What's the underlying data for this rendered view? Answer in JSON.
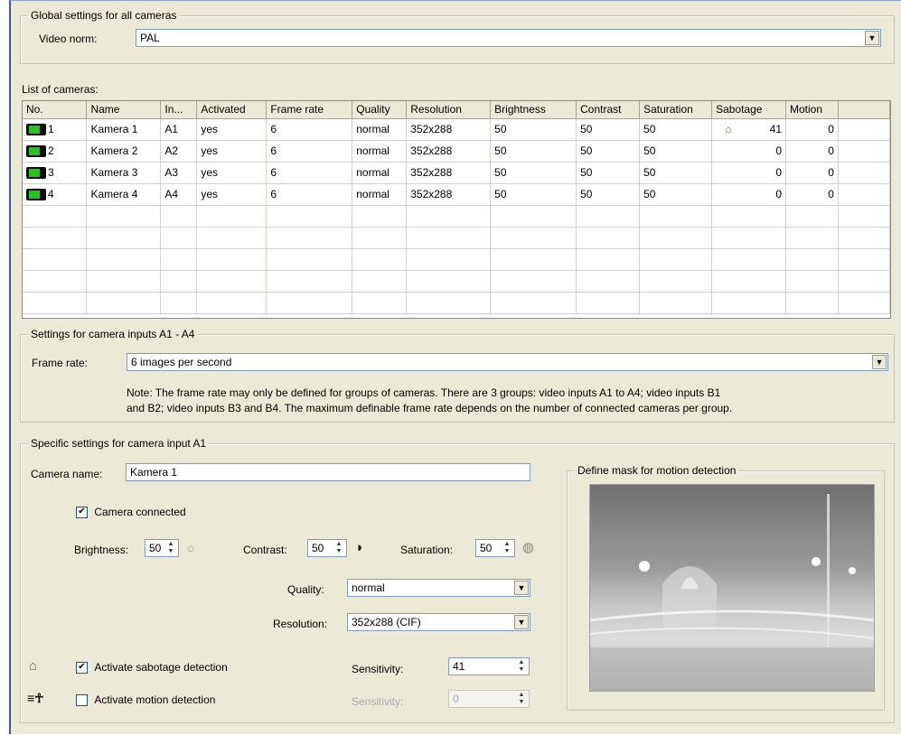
{
  "global": {
    "title": "Global settings for all cameras",
    "video_norm_label": "Video norm:",
    "video_norm_value": "PAL"
  },
  "list": {
    "label": "List of cameras:",
    "columns": [
      "No.",
      "Name",
      "In...",
      "Activated",
      "Frame rate",
      "Quality",
      "Resolution",
      "Brightness",
      "Contrast",
      "Saturation",
      "Sabotage",
      "Motion"
    ],
    "rows": [
      {
        "no": "1",
        "name": "Kamera 1",
        "input": "A1",
        "activated": "yes",
        "frame_rate": "6",
        "quality": "normal",
        "resolution": "352x288",
        "brightness": "50",
        "contrast": "50",
        "saturation": "50",
        "sabotage": "41",
        "motion": "0"
      },
      {
        "no": "2",
        "name": "Kamera 2",
        "input": "A2",
        "activated": "yes",
        "frame_rate": "6",
        "quality": "normal",
        "resolution": "352x288",
        "brightness": "50",
        "contrast": "50",
        "saturation": "50",
        "sabotage": "0",
        "motion": "0"
      },
      {
        "no": "3",
        "name": "Kamera 3",
        "input": "A3",
        "activated": "yes",
        "frame_rate": "6",
        "quality": "normal",
        "resolution": "352x288",
        "brightness": "50",
        "contrast": "50",
        "saturation": "50",
        "sabotage": "0",
        "motion": "0"
      },
      {
        "no": "4",
        "name": "Kamera 4",
        "input": "A4",
        "activated": "yes",
        "frame_rate": "6",
        "quality": "normal",
        "resolution": "352x288",
        "brightness": "50",
        "contrast": "50",
        "saturation": "50",
        "sabotage": "0",
        "motion": "0"
      }
    ]
  },
  "inputs": {
    "title": "Settings for camera inputs A1 - A4",
    "frame_rate_label": "Frame rate:",
    "frame_rate_value": "6 images per second",
    "note1": "Note: The frame rate may only be defined for groups of cameras. There are 3 groups: video inputs A1 to A4; video inputs B1",
    "note2": "and B2; video inputs B3 and B4. The maximum definable frame rate depends on the number of connected cameras per group."
  },
  "specific": {
    "title": "Specific settings for camera input A1",
    "camera_name_label": "Camera name:",
    "camera_name_value": "Kamera 1",
    "connected_label": "Camera connected",
    "brightness_label": "Brightness:",
    "brightness_value": "50",
    "contrast_label": "Contrast:",
    "contrast_value": "50",
    "saturation_label": "Saturation:",
    "saturation_value": "50",
    "quality_label": "Quality:",
    "quality_value": "normal",
    "resolution_label": "Resolution:",
    "resolution_value": "352x288 (CIF)",
    "sabotage_label": "Activate sabotage detection",
    "sabotage_sens_label": "Sensitivity:",
    "sabotage_sens_value": "41",
    "motion_label": "Activate motion detection",
    "motion_sens_label": "Sensitivity:",
    "motion_sens_value": "0",
    "mask_title": "Define mask for motion detection"
  }
}
